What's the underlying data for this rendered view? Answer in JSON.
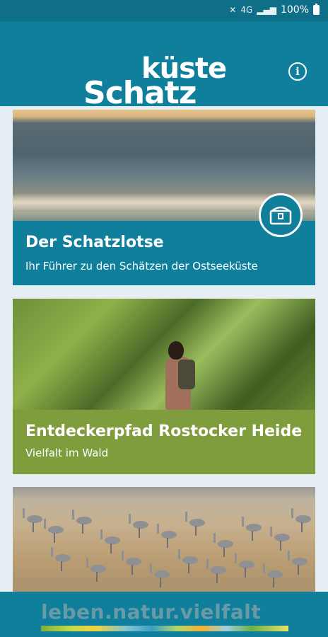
{
  "status_bar": {
    "battery_text": "100%"
  },
  "header": {
    "logo_line1": "küste",
    "logo_line2": "Schatz",
    "info_glyph": "i"
  },
  "cards": [
    {
      "title": "Der Schatzlotse",
      "subtitle": "Ihr Führer zu den Schätzen der Ostseeküste",
      "icon": "treasure-chest-icon"
    },
    {
      "title": "Entdeckerpfad Rostocker Heide",
      "subtitle": "Vielfalt im Wald"
    },
    {
      "title": "",
      "subtitle": ""
    }
  ],
  "footer": {
    "tagline": "leben.natur.vielfalt"
  },
  "colors": {
    "primary": "#0f7f9c",
    "green": "#7f9d3c"
  }
}
